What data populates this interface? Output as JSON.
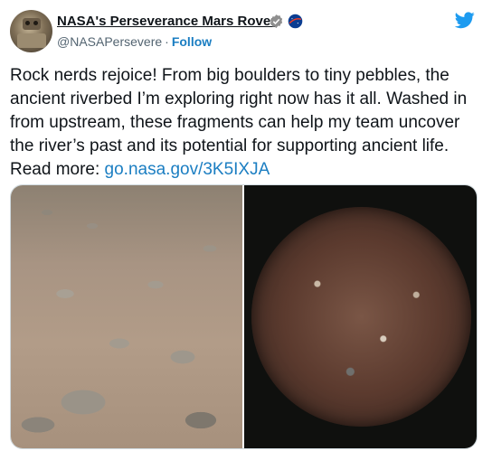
{
  "account": {
    "name": "NASA's Perseverance Mars Rover",
    "handle": "@NASAPersevere",
    "separator": "·",
    "follow_label": "Follow"
  },
  "tweet": {
    "text": "Rock nerds rejoice! From big boulders to tiny pebbles, the ancient riverbed I’m exploring right now has it all. Washed in from upstream, these fragments can help my team uncover the river’s past and its potential for supporting ancient life. Read more: ",
    "link": "go.nasa.gov/3K5IXJA"
  },
  "icons": {
    "verified": "verified-badge-icon",
    "nasa": "nasa-logo-icon",
    "brand": "twitter-bird-icon"
  },
  "colors": {
    "link": "#1b7ec2",
    "secondary_text": "#536471",
    "twitter_blue": "#1d9bf0",
    "nasa_blue": "#0b3d91",
    "nasa_red": "#fc3d21"
  },
  "media": [
    {
      "type": "photo",
      "subject": "rocks-and-boulders"
    },
    {
      "type": "photo",
      "subject": "rock-sample-closeup"
    }
  ]
}
